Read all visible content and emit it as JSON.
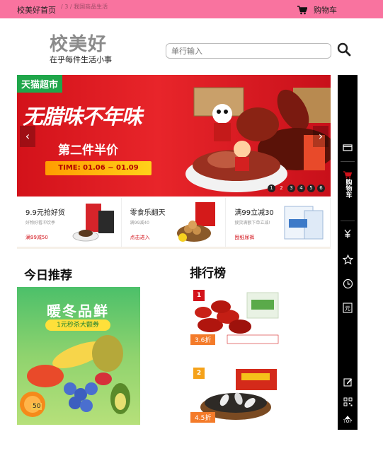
{
  "topbar": {
    "home": "校美好首页",
    "breadcrumb": "/  3 / 我国商品生活",
    "cart": "购物车"
  },
  "brand": {
    "logo": "校美好",
    "slogan": "在乎每件生活小事"
  },
  "search": {
    "placeholder": "单行输入"
  },
  "banner": {
    "badge": "天猫超市",
    "headline": "无腊味不年味",
    "subline": "第二件半价",
    "dates": "TIME:  01.06 ~ 01.09",
    "prev": "‹",
    "next": "›",
    "pages": [
      "1",
      "2",
      "3",
      "4",
      "5",
      "6"
    ],
    "active_page": 2
  },
  "promos": [
    {
      "title": "9.9元抢好货",
      "subtitle": "好物好看冲饮季",
      "link": "满99减50"
    },
    {
      "title": "零食乐翻天",
      "subtitle": "满99减40",
      "link": "点击进入"
    },
    {
      "title": "满99立减30",
      "subtitle": "搜货满额下单立减!",
      "link": "囤纸尿裤"
    }
  ],
  "sidebar": {
    "cart_label": "购物车",
    "top_label": "TOP"
  },
  "sections": {
    "today": "今日推荐",
    "rank": "排行榜"
  },
  "today": {
    "headline": "暖冬品鲜",
    "tag": "1元秒杀大额券",
    "badge": "50"
  },
  "rank_items": [
    {
      "rank": "1",
      "price": "3.6折"
    },
    {
      "rank": "2",
      "price": "4.5折"
    }
  ],
  "colors": {
    "topbar": "#f9739f",
    "banner_red": "#d3121a",
    "sidebar": "#000000",
    "accent_green": "#1fa64a"
  }
}
